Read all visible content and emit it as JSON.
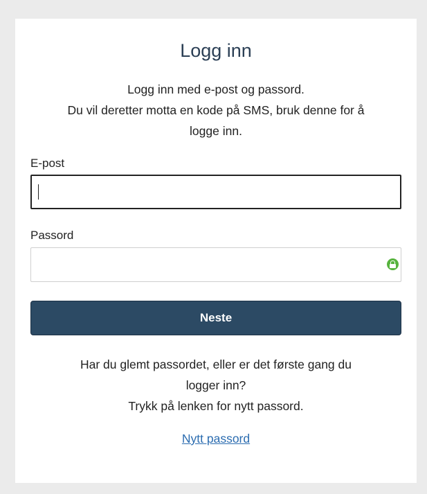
{
  "login": {
    "title": "Logg inn",
    "intro_line1": "Logg inn med e-post og passord.",
    "intro_line2": "Du vil deretter motta en kode på SMS, bruk denne for å",
    "intro_line3": "logge inn.",
    "email_label": "E-post",
    "email_value": "",
    "password_label": "Passord",
    "password_value": "",
    "password_manager_icon": "lock-icon",
    "password_manager_icon_color": "#57b33e",
    "submit_label": "Neste",
    "submit_color": "#2c4a64",
    "help_line1": "Har du glemt passordet, eller er det første gang du",
    "help_line2": "logger inn?",
    "help_line3": "Trykk på lenken for nytt passord.",
    "reset_link": "Nytt passord",
    "link_color": "#2b6cb0"
  }
}
